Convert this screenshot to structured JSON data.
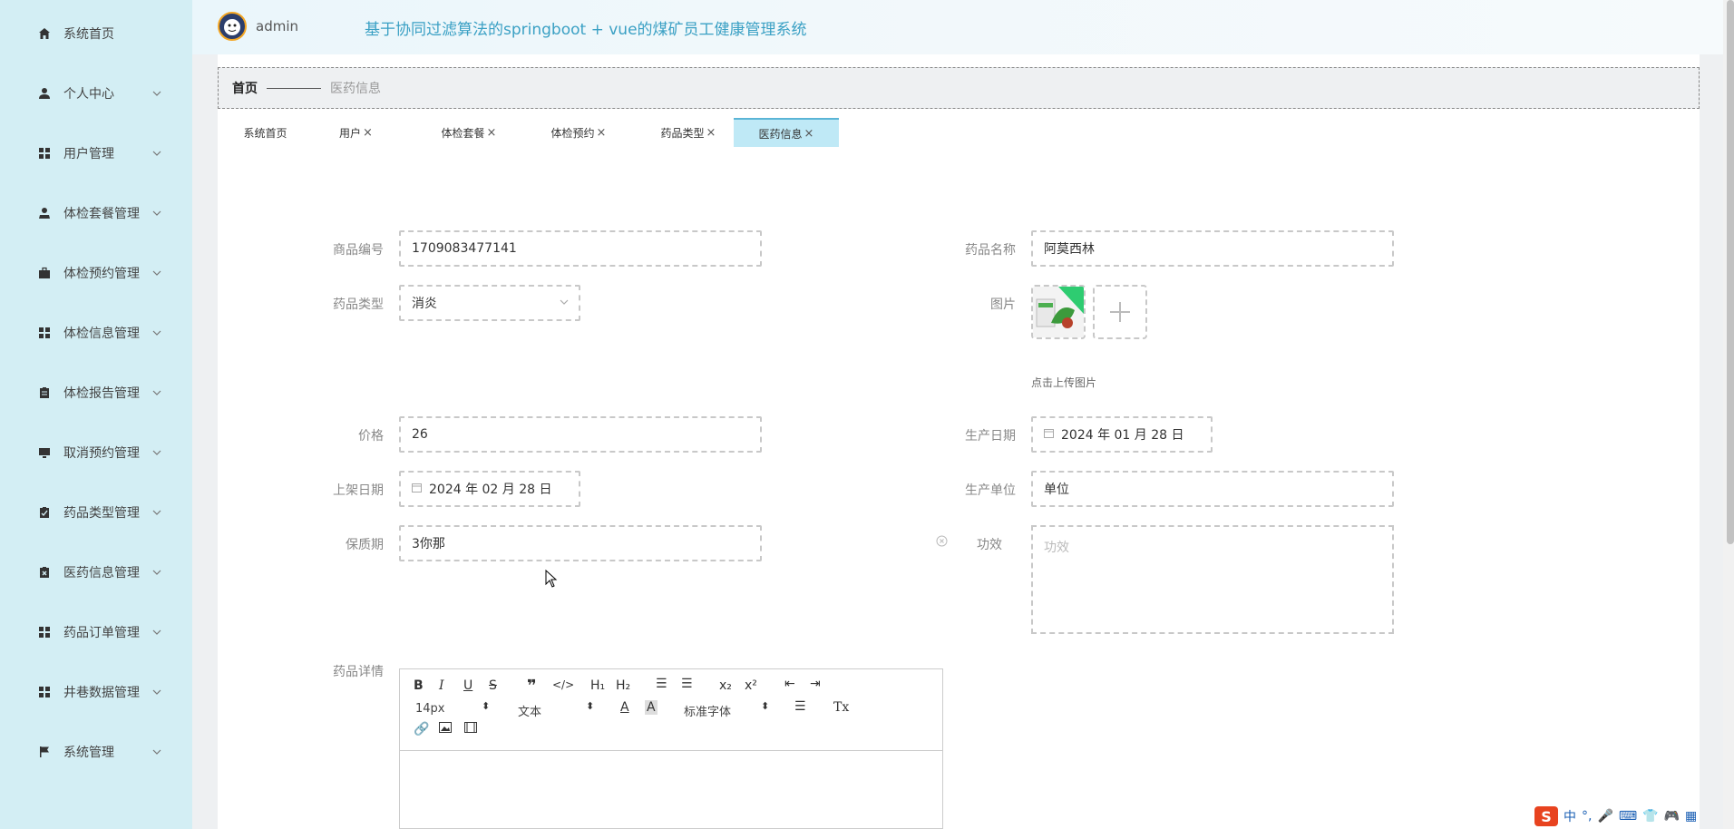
{
  "header": {
    "username": "admin",
    "system_title": "基于协同过滤算法的springboot + vue的煤矿员工健康管理系统"
  },
  "sidebar": {
    "items": [
      {
        "label": "系统首页",
        "icon": "home-icon"
      },
      {
        "label": "个人中心",
        "icon": "person-icon"
      },
      {
        "label": "用户管理",
        "icon": "grid-icon"
      },
      {
        "label": "体检套餐管理",
        "icon": "user-tie-icon"
      },
      {
        "label": "体检预约管理",
        "icon": "briefcase-icon"
      },
      {
        "label": "体检信息管理",
        "icon": "grid-icon"
      },
      {
        "label": "体检报告管理",
        "icon": "clipboard-icon"
      },
      {
        "label": "取消预约管理",
        "icon": "monitor-icon"
      },
      {
        "label": "药品类型管理",
        "icon": "clipboard-check-icon"
      },
      {
        "label": "医药信息管理",
        "icon": "clipboard-x-icon"
      },
      {
        "label": "药品订单管理",
        "icon": "grid-icon"
      },
      {
        "label": "井巷数据管理",
        "icon": "grid-icon"
      },
      {
        "label": "系统管理",
        "icon": "flag-icon"
      }
    ]
  },
  "breadcrumb": {
    "home": "首页",
    "current": "医药信息"
  },
  "tabs": [
    {
      "label": "系统首页",
      "closable": false,
      "active": false
    },
    {
      "label": "用户",
      "closable": true,
      "active": false
    },
    {
      "label": "体检套餐",
      "closable": true,
      "active": false
    },
    {
      "label": "体检预约",
      "closable": true,
      "active": false
    },
    {
      "label": "药品类型",
      "closable": true,
      "active": false
    },
    {
      "label": "医药信息",
      "closable": true,
      "active": true
    }
  ],
  "tab_close_glyph": "×",
  "form": {
    "product_code": {
      "label": "商品编号",
      "value": "1709083477141"
    },
    "drug_name": {
      "label": "药品名称",
      "value": "阿莫西林"
    },
    "drug_type": {
      "label": "药品类型",
      "value": "消炎"
    },
    "image": {
      "label": "图片",
      "upload_hint": "点击上传图片"
    },
    "price": {
      "label": "价格",
      "value": "26"
    },
    "production_date": {
      "label": "生产日期",
      "value": "2024 年 01 月 28 日"
    },
    "shelf_date": {
      "label": "上架日期",
      "value": "2024 年 02 月 28 日"
    },
    "manufacturer": {
      "label": "生产单位",
      "value": "单位"
    },
    "shelf_life": {
      "label": "保质期",
      "value": "3你那"
    },
    "efficacy": {
      "label": "功效",
      "placeholder": "功效"
    },
    "details": {
      "label": "药品详情"
    }
  },
  "editor": {
    "font_size": "14px",
    "paragraph": "文本",
    "font_family": "标准字体"
  },
  "ime": {
    "lang": "中"
  },
  "colors": {
    "sidebar_bg": "#d3eef4",
    "title_color": "#3aa0c4",
    "active_tab_bg": "#bfe9f6"
  }
}
